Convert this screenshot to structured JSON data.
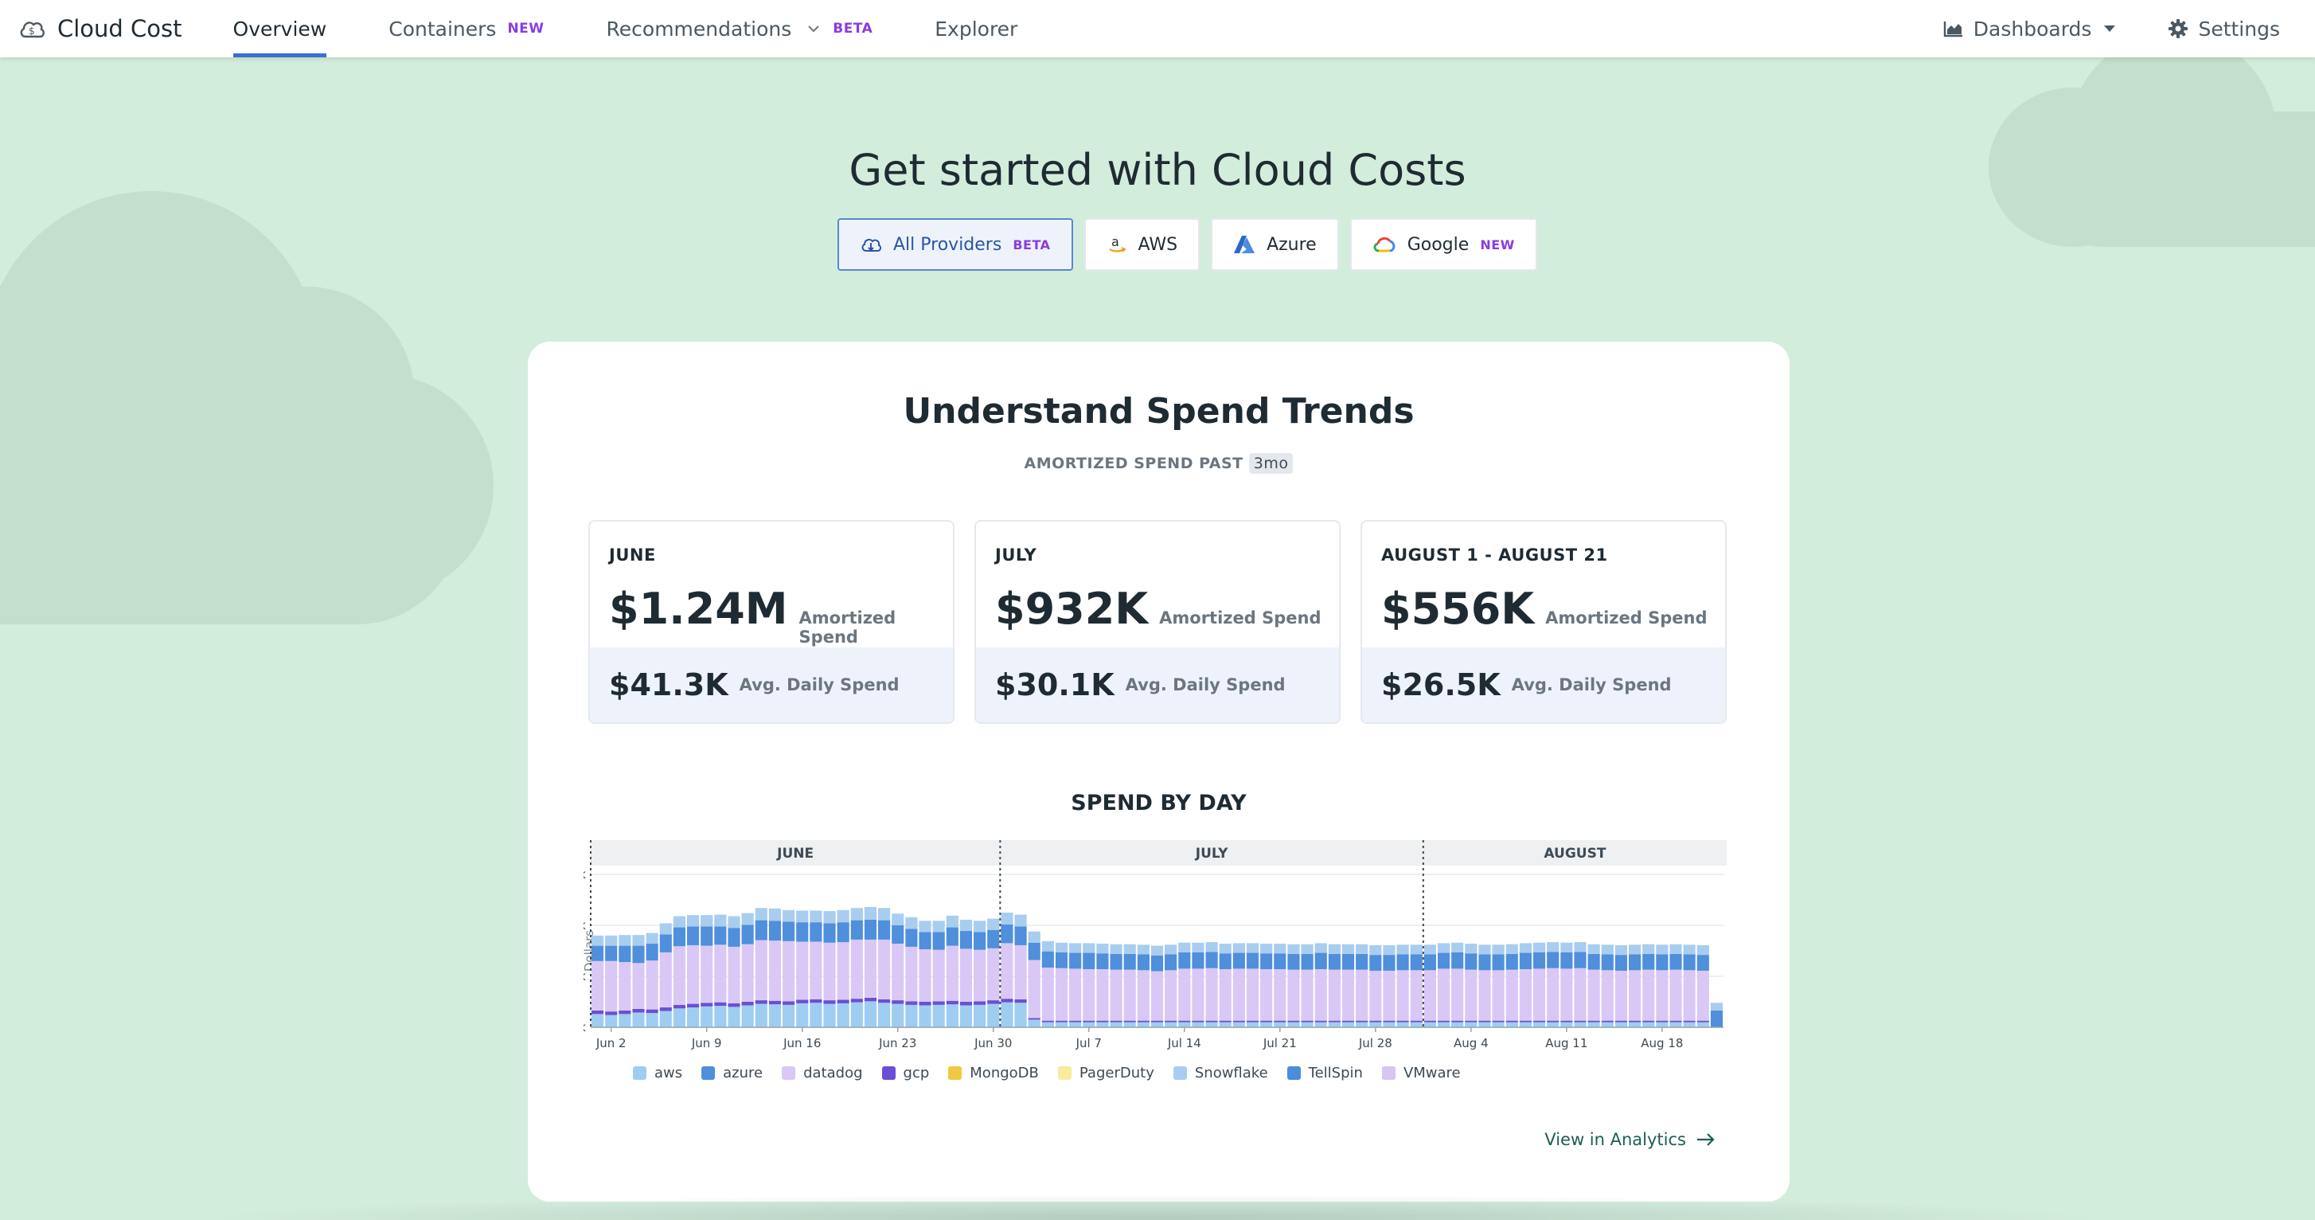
{
  "app": {
    "name": "Cloud Cost",
    "tabs": [
      {
        "label": "Overview",
        "tag": ""
      },
      {
        "label": "Containers",
        "tag": "NEW"
      },
      {
        "label": "Recommendations",
        "tag": "BETA"
      },
      {
        "label": "Explorer",
        "tag": ""
      }
    ],
    "dashboards_label": "Dashboards",
    "settings_label": "Settings"
  },
  "hero": {
    "title": "Get started with Cloud Costs",
    "providers": [
      {
        "label": "All Providers",
        "tag": "BETA",
        "icon": "cloud-dollar-icon"
      },
      {
        "label": "AWS",
        "tag": "",
        "icon": "amazon-icon"
      },
      {
        "label": "Azure",
        "tag": "",
        "icon": "azure-icon"
      },
      {
        "label": "Google",
        "tag": "NEW",
        "icon": "google-cloud-icon"
      }
    ]
  },
  "card": {
    "title": "Understand Spend Trends",
    "subtitle": "AMORTIZED SPEND PAST",
    "range": "3mo",
    "stats": [
      {
        "label": "JUNE",
        "amortized": "$1.24M",
        "amortized_unit": "Amortized Spend",
        "daily": "$41.3K",
        "daily_unit": "Avg. Daily Spend"
      },
      {
        "label": "JULY",
        "amortized": "$932K",
        "amortized_unit": "Amortized Spend",
        "daily": "$30.1K",
        "daily_unit": "Avg. Daily Spend"
      },
      {
        "label": "AUGUST 1 - AUGUST 21",
        "amortized": "$556K",
        "amortized_unit": "Amortized Spend",
        "daily": "$26.5K",
        "daily_unit": "Avg. Daily Spend"
      }
    ],
    "view_link": "View in Analytics"
  },
  "colors": {
    "aws": "#9fcdf2",
    "azure": "#4f8fdc",
    "datadog": "#d9c8f5",
    "gcp": "#6a4fd6",
    "MongoDB": "#f0c841",
    "PagerDuty": "#f6ec9b",
    "Snowflake": "#a8cdef",
    "TellSpin": "#4a8de0",
    "VMware": "#d6c6f3"
  },
  "chart_data": {
    "type": "bar",
    "title": "SPEND BY DAY",
    "ylabel": "Dollars",
    "ylim": [
      0,
      60000
    ],
    "yticks": [
      "0k",
      "20k",
      "40k",
      "60k"
    ],
    "xticks": [
      "Jun 2",
      "Jun 9",
      "Jun 16",
      "Jun 23",
      "Jun 30",
      "Jul 7",
      "Jul 14",
      "Jul 21",
      "Jul 28",
      "Aug 4",
      "Aug 11",
      "Aug 18"
    ],
    "month_bands": [
      "JUNE",
      "JULY",
      "AUGUST"
    ],
    "start_date": "2023-06-01",
    "legend": [
      "aws",
      "azure",
      "datadog",
      "gcp",
      "MongoDB",
      "PagerDuty",
      "Snowflake",
      "TellSpin",
      "VMware"
    ],
    "series": [
      {
        "name": "aws",
        "values": [
          5200,
          4800,
          5200,
          5800,
          5600,
          6400,
          7400,
          7800,
          8200,
          8400,
          8000,
          8600,
          9200,
          9000,
          8800,
          9400,
          9600,
          9200,
          9400,
          9800,
          10200,
          9600,
          9200,
          8800,
          8600,
          8800,
          9000,
          8600,
          8800,
          9200,
          9800,
          9600,
          3000,
          2000,
          2000,
          2000,
          2000,
          2000,
          2000,
          2000,
          2000,
          2000,
          2000,
          2000,
          2000,
          2000,
          2000,
          2000,
          2000,
          2000,
          2000,
          2000,
          2000,
          2000,
          2000,
          2000,
          2000,
          2000,
          2000,
          2000,
          2000,
          2000,
          2000,
          2000,
          2000,
          2000,
          2000,
          2000,
          2000,
          2000,
          2000,
          2000,
          2000,
          2000,
          2000,
          2000,
          2000,
          2000,
          2000,
          2000,
          2000,
          2000,
          0
        ]
      },
      {
        "name": "gcp",
        "values": [
          1400,
          1400,
          1400,
          1400,
          1400,
          1400,
          1400,
          1400,
          1400,
          1400,
          1400,
          1400,
          1400,
          1400,
          1400,
          1400,
          1400,
          1400,
          1400,
          1400,
          1400,
          1400,
          1400,
          1400,
          1400,
          1400,
          1400,
          1400,
          1400,
          1400,
          1400,
          1400,
          600,
          600,
          600,
          600,
          600,
          600,
          600,
          600,
          600,
          600,
          600,
          600,
          600,
          600,
          600,
          600,
          600,
          600,
          600,
          600,
          600,
          600,
          600,
          600,
          600,
          600,
          600,
          600,
          600,
          600,
          600,
          600,
          600,
          600,
          600,
          600,
          600,
          600,
          600,
          600,
          600,
          600,
          600,
          600,
          600,
          600,
          600,
          600,
          600,
          600,
          0
        ]
      },
      {
        "name": "datadog",
        "values": [
          19400,
          19800,
          19000,
          18000,
          19200,
          21600,
          23000,
          23000,
          22400,
          22600,
          22200,
          22600,
          23600,
          23600,
          23600,
          22800,
          22600,
          22600,
          22600,
          23200,
          22800,
          23400,
          22200,
          21400,
          20600,
          20200,
          21600,
          20800,
          20200,
          20400,
          21800,
          21200,
          22800,
          20800,
          20600,
          20400,
          20200,
          20200,
          20000,
          20000,
          19800,
          19400,
          19800,
          20400,
          20400,
          20600,
          20200,
          20400,
          20400,
          20200,
          20200,
          20000,
          20000,
          20200,
          20000,
          20000,
          20000,
          19600,
          19600,
          19800,
          19800,
          19800,
          20400,
          20400,
          20000,
          19800,
          19800,
          20000,
          20200,
          20400,
          20600,
          20400,
          20600,
          20000,
          19800,
          19600,
          19800,
          20000,
          19800,
          20000,
          19800,
          19600,
          0
        ]
      },
      {
        "name": "azure",
        "values": [
          6000,
          6000,
          6400,
          6800,
          6600,
          7000,
          7400,
          7400,
          7600,
          7200,
          7400,
          7600,
          7800,
          7800,
          7600,
          7600,
          7600,
          7600,
          7800,
          7600,
          7800,
          7600,
          7200,
          7000,
          6800,
          7000,
          7200,
          7000,
          7000,
          7200,
          7400,
          7400,
          6800,
          6400,
          6200,
          6200,
          6400,
          6200,
          6200,
          6200,
          6200,
          6200,
          6200,
          6400,
          6400,
          6400,
          6200,
          6200,
          6200,
          6200,
          6200,
          6200,
          6200,
          6400,
          6200,
          6200,
          6200,
          6200,
          6200,
          6200,
          6200,
          6200,
          6200,
          6400,
          6400,
          6200,
          6200,
          6200,
          6400,
          6400,
          6400,
          6400,
          6400,
          6200,
          6200,
          6200,
          6200,
          6200,
          6200,
          6200,
          6200,
          6200,
          6600
        ]
      },
      {
        "name": "Snowflake",
        "values": [
          4000,
          4000,
          4200,
          4200,
          4200,
          4400,
          4400,
          4400,
          4400,
          4600,
          4600,
          4600,
          4800,
          4800,
          4600,
          4600,
          4600,
          4800,
          4800,
          4800,
          5000,
          4800,
          4600,
          4600,
          4400,
          4400,
          4600,
          4400,
          4400,
          4400,
          4600,
          4600,
          4400,
          4000,
          3800,
          3800,
          3800,
          3800,
          3800,
          3800,
          3800,
          3800,
          3800,
          3800,
          3800,
          3800,
          3800,
          3800,
          3800,
          3800,
          3800,
          3800,
          3800,
          3800,
          3800,
          3800,
          3800,
          3800,
          3800,
          3800,
          3800,
          3800,
          3800,
          3800,
          3800,
          3800,
          3800,
          3800,
          3800,
          3800,
          3800,
          3800,
          3800,
          3800,
          3800,
          3800,
          3800,
          3800,
          3800,
          3800,
          3800,
          3800,
          3000
        ]
      }
    ]
  }
}
